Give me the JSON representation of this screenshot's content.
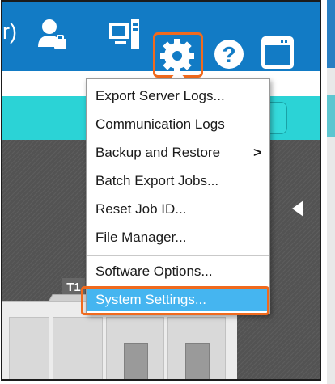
{
  "header": {
    "partial_text": "r)",
    "icons": [
      "user-admin-icon",
      "computer-icon",
      "gear-icon",
      "help-icon",
      "window-icon"
    ],
    "help_glyph": "?"
  },
  "printer": {
    "tray_label": "T1"
  },
  "menu": {
    "items": [
      {
        "label": "Export Server Logs..."
      },
      {
        "label": "Communication Logs"
      },
      {
        "label": "Backup and Restore",
        "submenu": ">"
      },
      {
        "label": "Batch Export Jobs..."
      },
      {
        "label": "Reset Job ID..."
      },
      {
        "label": "File Manager..."
      },
      {
        "label": "Software Options..."
      },
      {
        "label": "System Settings..."
      }
    ],
    "selected_index": 7
  },
  "colors": {
    "header_blue": "#127bc5",
    "teal_bar": "#2bd3d6",
    "highlight_orange": "#f06a1d",
    "selected_item": "#45b5f0"
  }
}
